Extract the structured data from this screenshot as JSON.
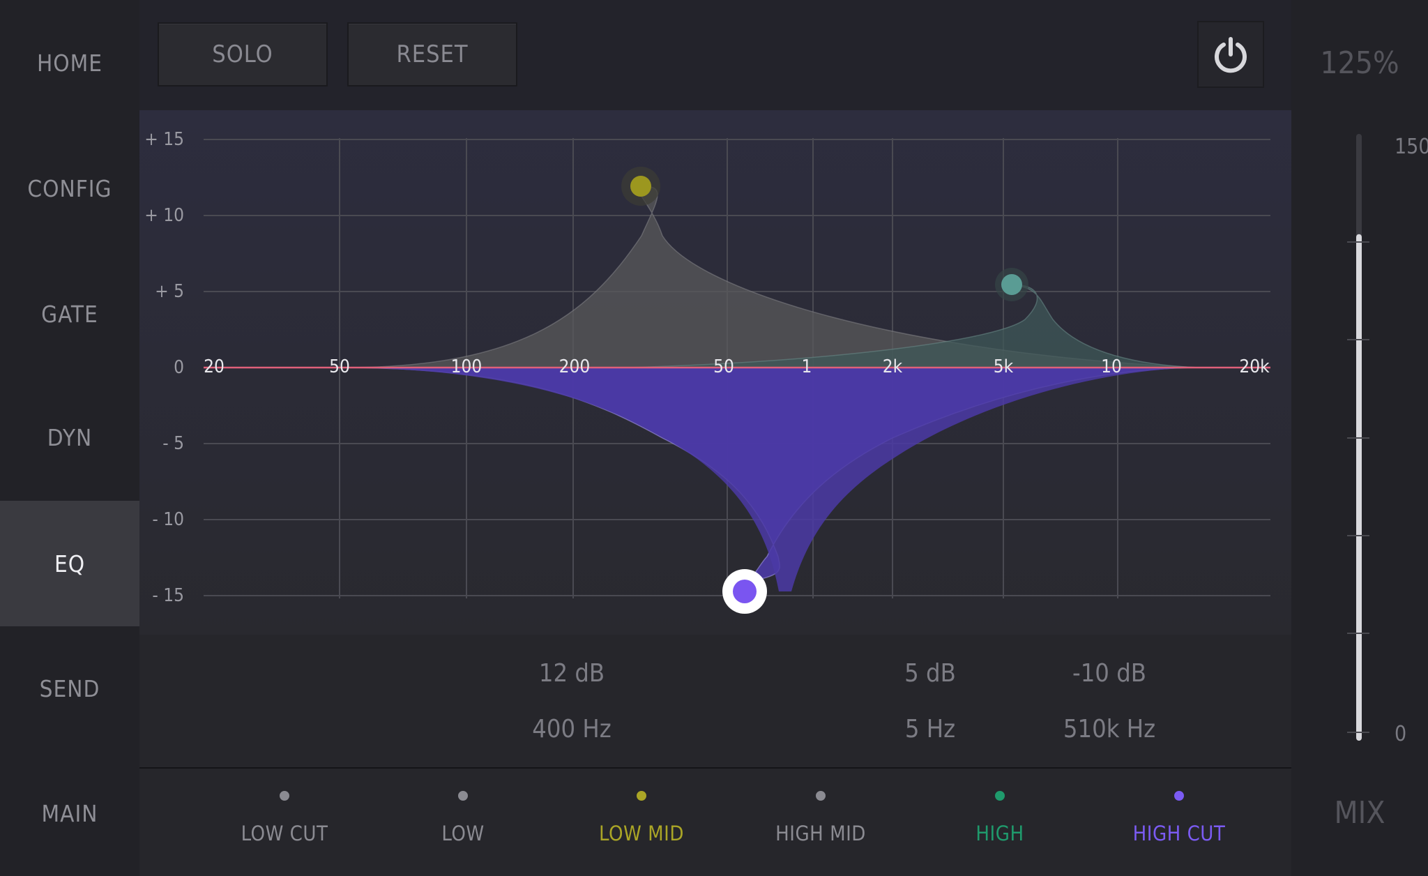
{
  "nav": {
    "items": [
      {
        "label": "HOME"
      },
      {
        "label": "CONFIG"
      },
      {
        "label": "GATE"
      },
      {
        "label": "DYN"
      },
      {
        "label": "EQ",
        "active": true
      },
      {
        "label": "SEND"
      },
      {
        "label": "MAIN"
      }
    ]
  },
  "toolbar": {
    "solo_label": "SOLO",
    "reset_label": "RESET",
    "power_icon": "power-icon"
  },
  "eq": {
    "y_labels": [
      "+ 15",
      "+ 10",
      "+ 5",
      "0",
      "- 5",
      "- 10",
      "- 15"
    ],
    "x_labels": [
      "20",
      "50",
      "100",
      "200",
      "50",
      "1",
      "2k",
      "5k",
      "10",
      "20k"
    ],
    "y_range": [
      -15,
      15
    ],
    "curves": [
      {
        "band": "LOW MID",
        "gain_db": 12,
        "color": "#a8a022"
      },
      {
        "band": "HIGH",
        "gain_db": 5,
        "color": "#4f9a92"
      },
      {
        "band": "HIGH CUT",
        "gain_db": -15,
        "color": "#7a55f0",
        "selected": true
      }
    ],
    "colors": {
      "zero_line": "#e0607a",
      "grid": "#55555c",
      "low_mid_fill": "#5a5a5a",
      "high_fill": "#3f5858",
      "high_cut_fill": "#4b3aa6"
    }
  },
  "readouts": [
    {
      "band": "LOW MID",
      "gain": "12 dB",
      "freq": "400 Hz"
    },
    {
      "band": "HIGH",
      "gain": "5 dB",
      "freq": "5 Hz"
    },
    {
      "band": "HIGH CUT",
      "gain": "-10 dB",
      "freq": "510k Hz"
    }
  ],
  "bands": [
    {
      "label": "LOW CUT",
      "color": "#8b8b92",
      "dot": "#8b8b92"
    },
    {
      "label": "LOW",
      "color": "#8b8b92",
      "dot": "#8b8b92"
    },
    {
      "label": "LOW MID",
      "color": "#aaa526",
      "dot": "#aaa526"
    },
    {
      "label": "HIGH MID",
      "color": "#8b8b92",
      "dot": "#8b8b92"
    },
    {
      "label": "HIGH",
      "color": "#1f9a6c",
      "dot": "#1f9a6c"
    },
    {
      "label": "HIGH CUT",
      "color": "#7b5bf3",
      "dot": "#7b5bf3"
    }
  ],
  "mix": {
    "zoom": "125%",
    "scale_max": "150",
    "scale_min": "0",
    "level": 125,
    "label": "MIX"
  }
}
